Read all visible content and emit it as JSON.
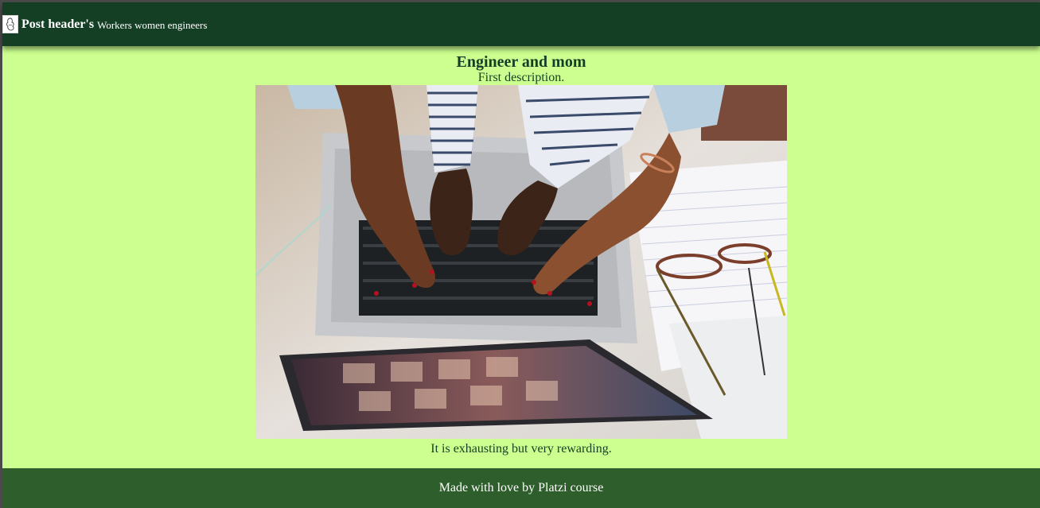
{
  "header": {
    "logo_icon": "woman-silhouette-icon",
    "title": "Post header's",
    "subtitle": "Workers women engineers"
  },
  "post": {
    "title": "Engineer and mom",
    "description": "First description.",
    "image_icon": "hands-typing-laptop-photo",
    "caption": "It is exhausting but very rewarding."
  },
  "footer": {
    "text": "Made with love by Platzi course"
  },
  "colors": {
    "header_bg": "#143f25",
    "page_bg": "#ccff8f",
    "footer_bg": "#2d5e2b",
    "text_dark_green": "#143f25"
  }
}
